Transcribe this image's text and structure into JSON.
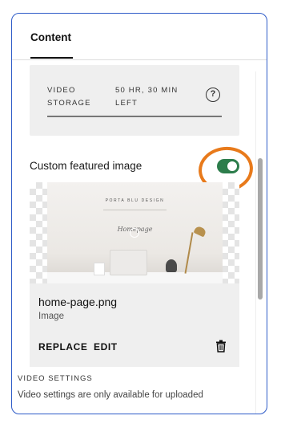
{
  "tabs": {
    "content_label": "Content"
  },
  "storage": {
    "label": "VIDEO\nSTORAGE",
    "value": "50 HR, 30 MIN\nLEFT",
    "help_icon": "question-circle-icon"
  },
  "featured_image": {
    "label": "Custom featured image",
    "toggle_on": true,
    "accent_color": "#2c7d4b",
    "highlight_color": "#e87a1b"
  },
  "image": {
    "thumbnail_brand": "PORTA BLU DESIGN",
    "thumbnail_script": "Homepage",
    "file_name": "home-page.png",
    "file_type": "Image",
    "replace_label": "REPLACE",
    "edit_label": "EDIT",
    "delete_icon": "trash-icon"
  },
  "video_settings": {
    "heading": "VIDEO SETTINGS",
    "text": "Video settings are only available for uploaded"
  },
  "colors": {
    "border_focus": "#2f5cc8"
  }
}
